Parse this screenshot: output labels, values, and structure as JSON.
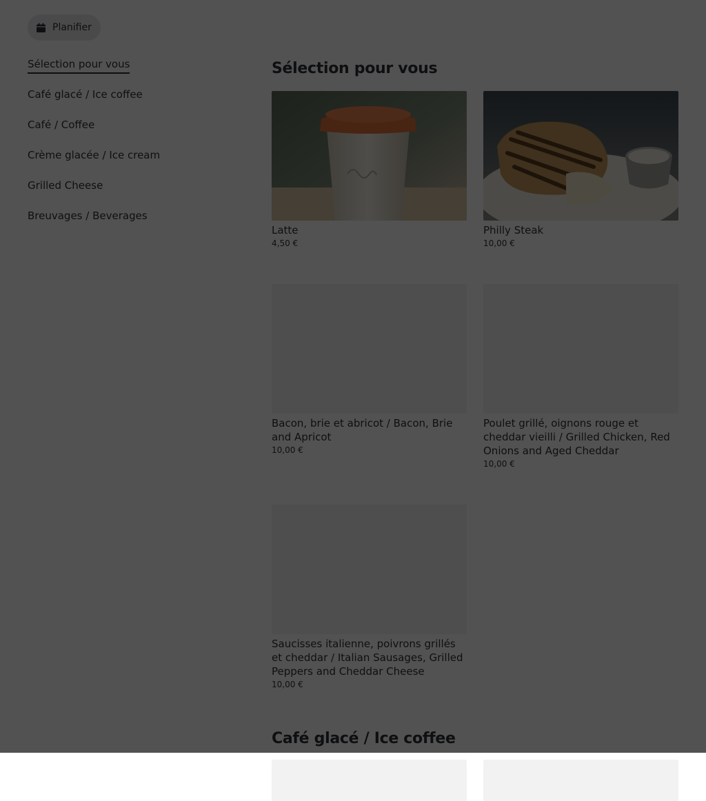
{
  "schedule_button": {
    "label": "Planifier",
    "icon": "calendar-icon"
  },
  "sidebar": {
    "items": [
      {
        "label": "Sélection pour vous",
        "active": true
      },
      {
        "label": "Café glacé / Ice coffee",
        "active": false
      },
      {
        "label": "Café / Coffee",
        "active": false
      },
      {
        "label": "Crème glacée / Ice cream",
        "active": false
      },
      {
        "label": "Grilled Cheese",
        "active": false
      },
      {
        "label": "Breuvages / Beverages",
        "active": false
      }
    ]
  },
  "sections": [
    {
      "title": "Sélection pour vous",
      "items": [
        {
          "name": "Latte",
          "price": "4,50 €",
          "image": "latte-cup-photo"
        },
        {
          "name": "Philly Steak",
          "price": "10,00 €",
          "image": "grilled-sandwich-photo"
        },
        {
          "name": "Bacon, brie et abricot / Bacon, Brie and Apricot",
          "price": "10,00 €",
          "image": "placeholder"
        },
        {
          "name": "Poulet grillé, oignons rouge et cheddar vieilli / Grilled Chicken, Red Onions and Aged Cheddar",
          "price": "10,00 €",
          "image": "placeholder"
        },
        {
          "name": "Saucisses italienne, poivrons grillés et cheddar / Italian Sausages, Grilled Peppers and Cheddar Cheese",
          "price": "10,00 €",
          "image": "placeholder"
        }
      ]
    },
    {
      "title": "Café glacé / Ice coffee",
      "items": []
    }
  ],
  "colors": {
    "text": "#2d3137",
    "placeholder": "#f2f2f2",
    "button_bg": "#e7e7e7",
    "overlay": "rgba(0,0,0,0.68)"
  }
}
